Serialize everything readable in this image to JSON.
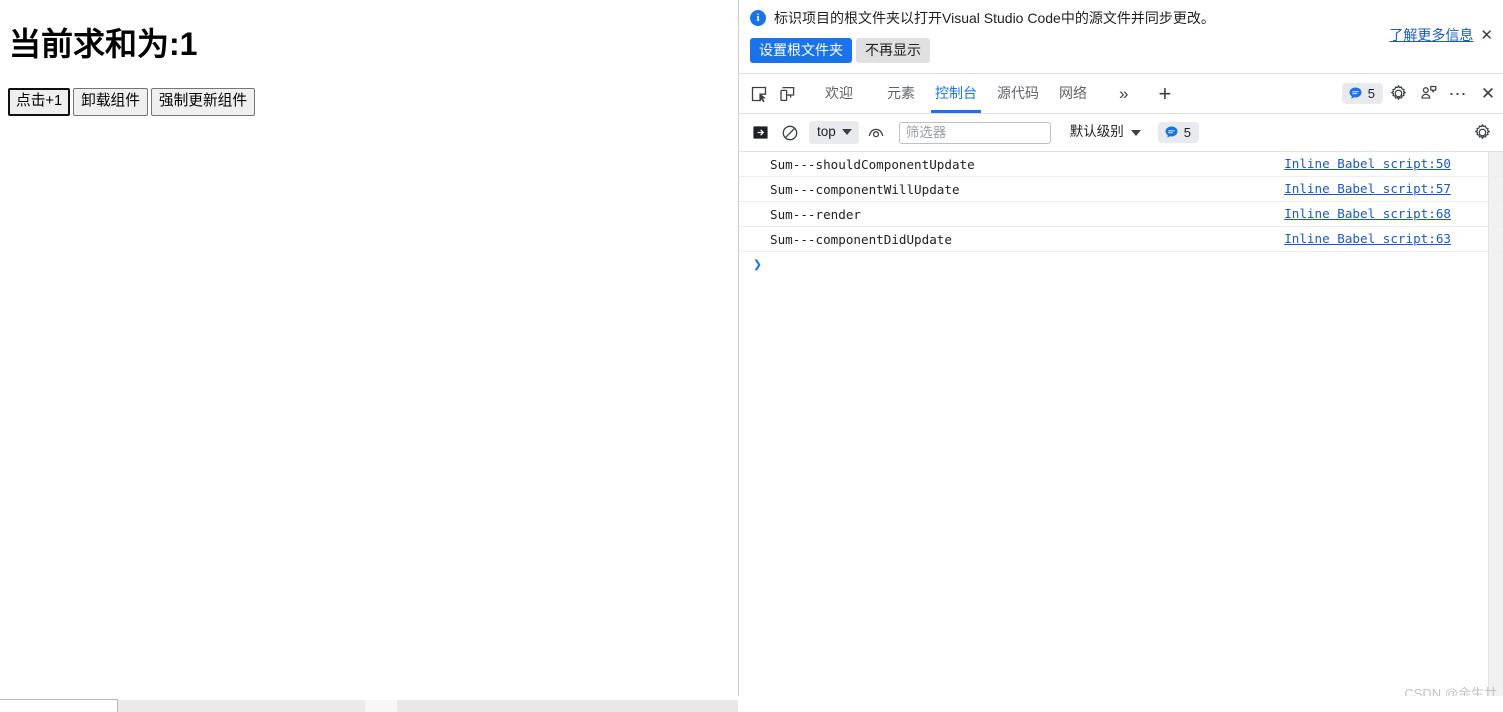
{
  "page": {
    "title": "当前求和为:1",
    "buttons": [
      {
        "label": "点击+1",
        "focused": true
      },
      {
        "label": "卸载组件",
        "focused": false
      },
      {
        "label": "强制更新组件",
        "focused": false
      }
    ]
  },
  "devtools": {
    "infobar": {
      "icon": "info-icon",
      "message": "标识项目的根文件夹以打开Visual Studio Code中的源文件并同步更改。",
      "primary_button": "设置根文件夹",
      "secondary_button": "不再显示",
      "learn_more": "了解更多信息",
      "close": "✕"
    },
    "tabbar": {
      "inspect_icon": "inspect-element-icon",
      "device_icon": "device-toolbar-icon",
      "tabs": [
        {
          "label": "欢迎",
          "active": false
        },
        {
          "label": "元素",
          "active": false
        },
        {
          "label": "控制台",
          "active": true
        },
        {
          "label": "源代码",
          "active": false
        },
        {
          "label": "网络",
          "active": false
        }
      ],
      "more_tabs": "»",
      "add_tab": "+",
      "issues_count": "5",
      "issues_icon": "message-bubble-icon",
      "settings_icon": "gear-icon",
      "assistant_icon": "ai-assistant-icon",
      "more_icon": "more-options-icon",
      "close_icon": "close-icon"
    },
    "console_toolbar": {
      "sidebar_icon": "console-sidebar-icon",
      "clear_icon": "clear-console-icon",
      "context": "top",
      "live_expression_icon": "eye-icon",
      "filter_placeholder": "筛选器",
      "filter_value": "",
      "level": "默认级别",
      "issues_count": "5",
      "issues_icon": "message-bubble-icon",
      "settings_icon": "gear-icon"
    },
    "console_logs": [
      {
        "text": "Sum---shouldComponentUpdate",
        "source": "Inline Babel script:50"
      },
      {
        "text": "Sum---componentWillUpdate",
        "source": "Inline Babel script:57"
      },
      {
        "text": "Sum---render",
        "source": "Inline Babel script:68"
      },
      {
        "text": "Sum---componentDidUpdate",
        "source": "Inline Babel script:63"
      }
    ],
    "prompt": "❯"
  },
  "watermark": "CSDN @余生廿",
  "colors": {
    "accent": "#1a73e8",
    "link": "#1a58c9",
    "text": "#202124",
    "muted": "#5f6368"
  }
}
